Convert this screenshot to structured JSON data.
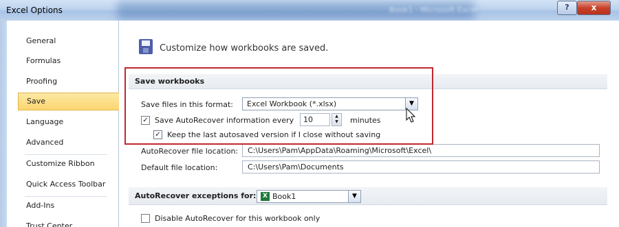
{
  "window": {
    "title": "Excel Options",
    "blurred_title": "Book1 - Microsoft Excel",
    "help_label": "?",
    "close_label": "x"
  },
  "nav": {
    "items": [
      {
        "label": "General",
        "selected": false
      },
      {
        "label": "Formulas",
        "selected": false
      },
      {
        "label": "Proofing",
        "selected": false
      },
      {
        "label": "Save",
        "selected": true
      },
      {
        "label": "Language",
        "selected": false
      },
      {
        "label": "Advanced",
        "selected": false
      },
      {
        "label": "Customize Ribbon",
        "selected": false
      },
      {
        "label": "Quick Access Toolbar",
        "selected": false
      },
      {
        "label": "Add-Ins",
        "selected": false
      },
      {
        "label": "Trust Center",
        "selected": false
      }
    ]
  },
  "content": {
    "header_icon": "floppy-disk-icon",
    "header_text": "Customize how workbooks are saved.",
    "save_workbooks": {
      "section_title": "Save workbooks",
      "format_label": "Save files in this format:",
      "format_value": "Excel Workbook (*.xlsx)",
      "autorecover_label": "Save AutoRecover information every",
      "autorecover_checked": true,
      "autorecover_minutes": "10",
      "minutes_label": "minutes",
      "keep_last_label": "Keep the last autosaved version if I close without saving",
      "keep_last_checked": true,
      "autorecover_location_label": "AutoRecover file location:",
      "autorecover_location_value": "C:\\Users\\Pam\\AppData\\Roaming\\Microsoft\\Excel\\",
      "default_location_label": "Default file location:",
      "default_location_value": "C:\\Users\\Pam\\Documents"
    },
    "exceptions": {
      "section_title": "AutoRecover exceptions for:",
      "workbook_value": "Book1",
      "disable_label": "Disable AutoRecover for this workbook only",
      "disable_checked": false
    }
  },
  "colors": {
    "highlight_border": "#c0272d",
    "selected_nav": "#fbd66f"
  }
}
